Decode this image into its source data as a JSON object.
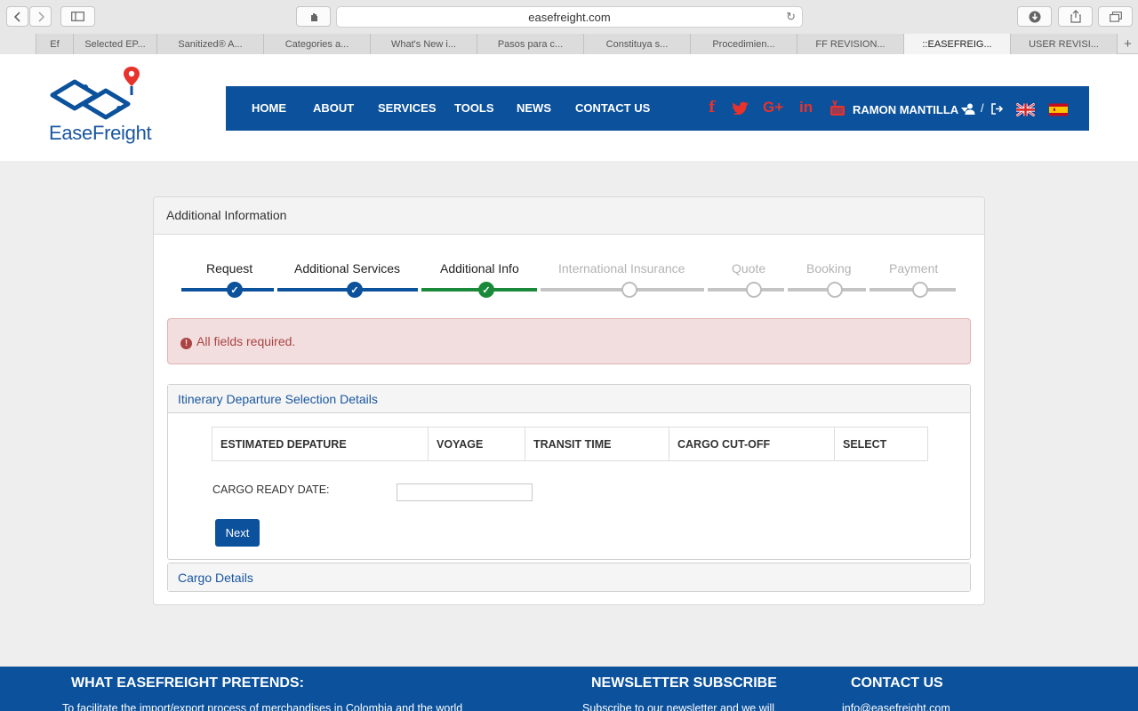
{
  "browser": {
    "url": "easefreight.com",
    "tabs": [
      "Ef",
      "Selected EP...",
      "Sanitized® A...",
      "Categories a...",
      "What's New i...",
      "Pasos para c...",
      "Constituya s...",
      "Procedimien...",
      "FF REVISION...",
      "::EASEFREIG...",
      "USER REVISI..."
    ],
    "active_tab_index": 9,
    "add_tab": "+"
  },
  "brand": {
    "name": "EaseFreight",
    "color": "#0b519c",
    "accent": "#e8322c"
  },
  "nav": {
    "items": [
      "HOME",
      "ABOUT",
      "SERVICES",
      "TOOLS",
      "NEWS",
      "CONTACT US"
    ],
    "social": [
      "f",
      "t",
      "G+",
      "in",
      "yt"
    ],
    "user": "RAMON MANTILLA",
    "separator": "/",
    "languages": [
      "uk-flag",
      "es-flag"
    ]
  },
  "card": {
    "title": "Additional Information",
    "steps": [
      {
        "label": "Request",
        "status": "done"
      },
      {
        "label": "Additional Services",
        "status": "done"
      },
      {
        "label": "Additional Info",
        "status": "current"
      },
      {
        "label": "International Insurance",
        "status": "pending"
      },
      {
        "label": "Quote",
        "status": "pending"
      },
      {
        "label": "Booking",
        "status": "pending"
      },
      {
        "label": "Payment",
        "status": "pending"
      }
    ],
    "alert": "All fields required.",
    "itinerary": {
      "title": "Itinerary Departure Selection Details",
      "columns": [
        "ESTIMATED DEPATURE",
        "VOYAGE",
        "TRANSIT TIME",
        "CARGO CUT-OFF",
        "SELECT"
      ],
      "ready_label": "CARGO READY DATE:",
      "ready_value": "",
      "next_label": "Next"
    },
    "cargo": {
      "title": "Cargo Details"
    }
  },
  "footer": {
    "pretends_title": "WHAT EASEFREIGHT PRETENDS:",
    "pretends_text": "To facilitate the import/export process of merchandises in Colombia and the world",
    "newsletter_title": "NEWSLETTER SUBSCRIBE",
    "newsletter_text": "Subscribe to our newsletter and we will",
    "contact_title": "CONTACT US",
    "contact_text": "info@easefreight.com"
  }
}
